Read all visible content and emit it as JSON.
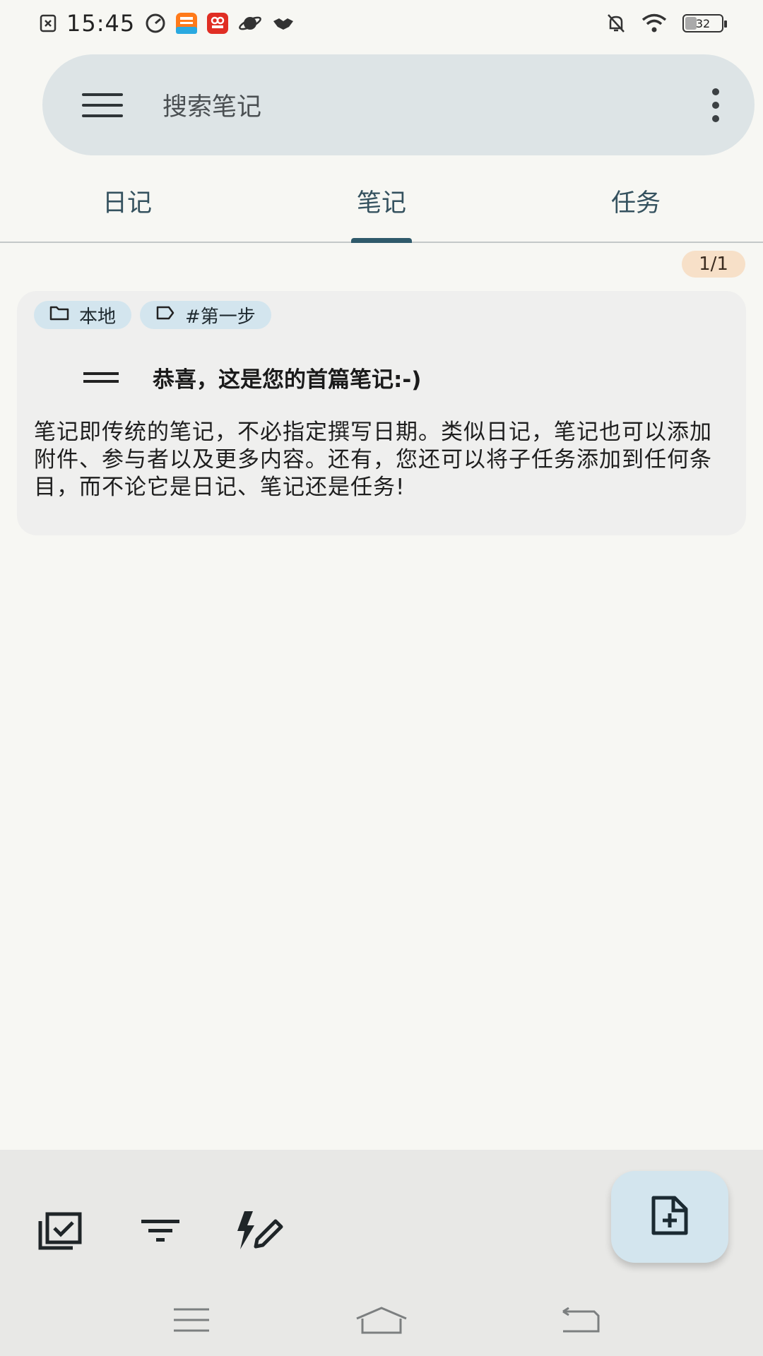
{
  "status_bar": {
    "time": "15:45",
    "battery": "32",
    "icons": [
      "sim-error-icon",
      "speed-icon",
      "taobao-app-icon",
      "pinduoduo-app-icon",
      "planet-icon",
      "handshake-icon",
      "mute-icon",
      "wifi-icon",
      "battery-icon"
    ]
  },
  "search": {
    "placeholder": "搜索笔记"
  },
  "tabs": [
    {
      "label": "日记",
      "active": false
    },
    {
      "label": "笔记",
      "active": true
    },
    {
      "label": "任务",
      "active": false
    }
  ],
  "counter": "1/1",
  "note": {
    "collection": "本地",
    "tag": "#第一步",
    "title": "恭喜，这是您的首篇笔记:-)",
    "body": "笔记即传统的笔记，不必指定撰写日期。类似日记，笔记也可以添加附件、参与者以及更多内容。还有，您还可以将子任务添加到任何条目，而不论它是日记、笔记还是任务!"
  },
  "bottom_bar": {
    "icons": [
      "multi-select-icon",
      "filter-icon",
      "quick-add-icon"
    ],
    "fab_icon": "add-note-icon"
  },
  "colors": {
    "background": "#f7f7f3",
    "search_bg": "#dde4e6",
    "tab_text": "#35525f",
    "tab_indicator": "#2f5a6b",
    "chip_bg": "#d3e5ee",
    "counter_bg": "#f7e0c8",
    "card_bg": "#efefee",
    "fab_bg": "#d3e5ee"
  }
}
